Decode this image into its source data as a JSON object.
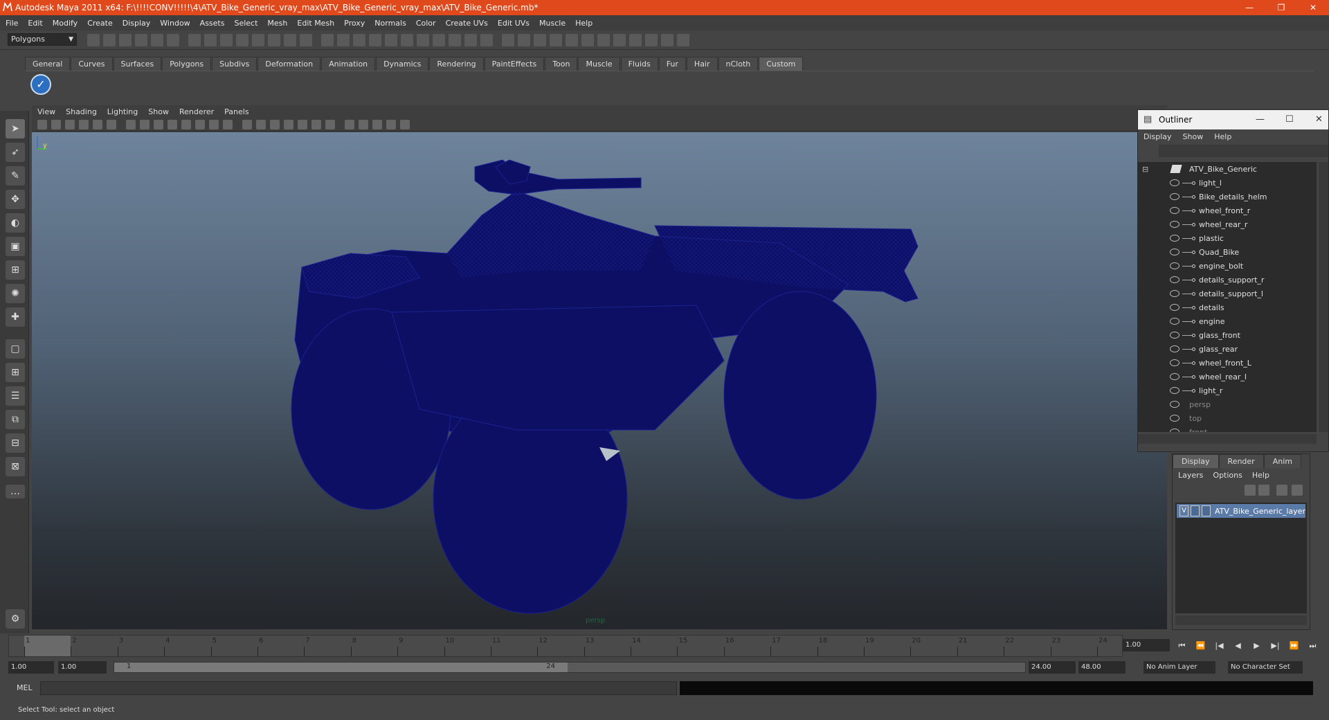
{
  "window": {
    "title": "Autodesk Maya 2011 x64: F:\\!!!!CONV!!!!!\\4\\ATV_Bike_Generic_vray_max\\ATV_Bike_Generic_vray_max\\ATV_Bike_Generic.mb*",
    "minimize": "—",
    "maximize": "❐",
    "close": "✕"
  },
  "menu": [
    "File",
    "Edit",
    "Modify",
    "Create",
    "Display",
    "Window",
    "Assets",
    "Select",
    "Mesh",
    "Edit Mesh",
    "Proxy",
    "Normals",
    "Color",
    "Create UVs",
    "Edit UVs",
    "Muscle",
    "Help"
  ],
  "mode": "Polygons",
  "shelf_tabs": [
    "General",
    "Curves",
    "Surfaces",
    "Polygons",
    "Subdivs",
    "Deformation",
    "Animation",
    "Dynamics",
    "Rendering",
    "PaintEffects",
    "Toon",
    "Muscle",
    "Fluids",
    "Fur",
    "Hair",
    "nCloth",
    "Custom"
  ],
  "active_shelf": "Custom",
  "viewport_menu": [
    "View",
    "Shading",
    "Lighting",
    "Show",
    "Renderer",
    "Panels"
  ],
  "viewport_label": "persp",
  "outliner": {
    "title": "Outliner",
    "menu": [
      "Display",
      "Show",
      "Help"
    ],
    "root": "ATV_Bike_Generic",
    "children": [
      "light_l",
      "Bike_details_helm",
      "wheel_front_r",
      "wheel_rear_r",
      "plastic",
      "Quad_Bike",
      "engine_bolt",
      "details_support_r",
      "details_support_l",
      "details",
      "engine",
      "glass_front",
      "glass_rear",
      "wheel_front_L",
      "wheel_rear_l",
      "light_r"
    ],
    "cameras": [
      "persp",
      "top",
      "front"
    ]
  },
  "layers": {
    "tabs": [
      "Display",
      "Render",
      "Anim"
    ],
    "menu": [
      "Layers",
      "Options",
      "Help"
    ],
    "layer": {
      "visible": "V",
      "name": "ATV_Bike_Generic_layer"
    }
  },
  "timeline": {
    "ticks": [
      "1",
      "2",
      "3",
      "4",
      "5",
      "6",
      "7",
      "8",
      "9",
      "10",
      "11",
      "12",
      "13",
      "14",
      "15",
      "16",
      "17",
      "18",
      "19",
      "20",
      "21",
      "22",
      "23",
      "24"
    ],
    "current_frame": "1.00",
    "playback": [
      "⏮",
      "⏪",
      "|◀",
      "◀",
      "▶",
      "▶|",
      "⏩",
      "⏭"
    ]
  },
  "range": {
    "start": "1.00",
    "playback_start": "1.00",
    "handle_start": "1",
    "handle_end": "24",
    "playback_end": "24.00",
    "end": "48.00",
    "anim_layer": "No Anim Layer",
    "character_set": "No Character Set"
  },
  "command": {
    "label": "MEL"
  },
  "help_line": "Select Tool: select an object"
}
